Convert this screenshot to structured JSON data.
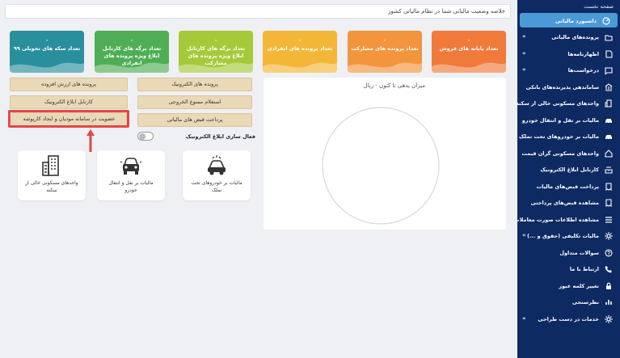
{
  "summary": {
    "text": "خلاصه وضعیت مالیاتی شما در نظام مالیاتی کشور"
  },
  "cards": [
    {
      "count": "۰",
      "label": "تعداد پایانه های فروش",
      "color": "#f07a3a"
    },
    {
      "count": "۰",
      "label": "تعداد پرونده های مشارکت",
      "color": "#f2953d"
    },
    {
      "count": "۰",
      "label": "تعداد پرونده های انفرادی",
      "color": "#f4b637"
    },
    {
      "count": "۰",
      "label": "تعداد برگه های کارتابل ابلاغ ویژه پرونده های مشارکت",
      "color": "#a6c93a"
    },
    {
      "count": "۰",
      "label": "تعداد برگه های کارتابل ابلاغ ویژه پرونده های انفرادی",
      "color": "#4fae55"
    },
    {
      "count": "۰",
      "label": "تعداد سکه های تحویلی ۹۹",
      "color": "#2a8f9c"
    }
  ],
  "buttons": {
    "value_added_files": "پرونده های ارزش افزوده",
    "electronic_files": "پرونده های الکترونیک",
    "eblagh_cartable": "کارتابل ابلاغ الکترونیک",
    "exit_ban_inquiry": "استعلام ممنوع الخروجی",
    "membership_vehicle": "عضویت در سامانه مودیان و ایجاد کارپوشه",
    "tax_bill_payment": "پرداخت قبض های مالیاتی"
  },
  "toggle": {
    "label": "فعال سازی ابلاغ الکترونیک"
  },
  "tiles": [
    {
      "label": "مالیات بر خودروهای تحت تملک"
    },
    {
      "label": "مالیات بر نقل و انتقال خودرو"
    },
    {
      "label": "واحدهای مسکونی خالی از سکنه"
    }
  ],
  "chart": {
    "title": "میزان بدهی تا کنون - ریال"
  },
  "sidebar": {
    "header": "صفحه نخست",
    "items": [
      {
        "label": "داشبورد مالیاتی",
        "icon": "dashboard-icon",
        "chevron": false,
        "active": true
      },
      {
        "label": "پرونده‌های مالیاتی",
        "icon": "folder-icon",
        "chevron": true,
        "active": false
      },
      {
        "label": "اظهارنامه‌ها",
        "icon": "document-icon",
        "chevron": true,
        "active": false
      },
      {
        "label": "درخواست‌ها",
        "icon": "request-icon",
        "chevron": true,
        "active": false
      },
      {
        "label": "ساماندهی پذیرنده‌های بانکی",
        "icon": "bank-icon",
        "chevron": false,
        "active": false
      },
      {
        "label": "واحدهای مسکونی خالی از سکنه",
        "icon": "building-icon",
        "chevron": false,
        "active": false
      },
      {
        "label": "مالیات بر نقل و انتقال خودرو",
        "icon": "car-icon",
        "chevron": false,
        "active": false
      },
      {
        "label": "مالیات بر خودروهای تحت تملک",
        "icon": "car-icon",
        "chevron": false,
        "active": false
      },
      {
        "label": "واحدهای مسکونی گران قیمت",
        "icon": "home-icon",
        "chevron": false,
        "active": false
      },
      {
        "label": "کارتابل ابلاغ الکترونیک",
        "icon": "inbox-icon",
        "chevron": false,
        "active": false
      },
      {
        "label": "پرداخت قبض‌های مالیات",
        "icon": "receipt-icon",
        "chevron": false,
        "active": false
      },
      {
        "label": "مشاهده قبض‌های پرداختی",
        "icon": "receipt-icon",
        "chevron": false,
        "active": false
      },
      {
        "label": "مشاهده اطلاعات صورت معاملات",
        "icon": "list-icon",
        "chevron": false,
        "active": false
      },
      {
        "label": "مالیات تکلیفی (حقوق و ...)",
        "icon": "gear-icon",
        "chevron": true,
        "active": false
      },
      {
        "label": "سوالات متداول",
        "icon": "question-icon",
        "chevron": false,
        "active": false
      },
      {
        "label": "ارتباط با ما",
        "icon": "phone-icon",
        "chevron": false,
        "active": false
      },
      {
        "label": "تغییر کلمه عبور",
        "icon": "lock-icon",
        "chevron": false,
        "active": false
      },
      {
        "label": "نظرسنجی",
        "icon": "survey-icon",
        "chevron": false,
        "active": false
      },
      {
        "label": "خدمات در دست طراحی",
        "icon": "gear-icon",
        "chevron": true,
        "active": false
      }
    ]
  }
}
